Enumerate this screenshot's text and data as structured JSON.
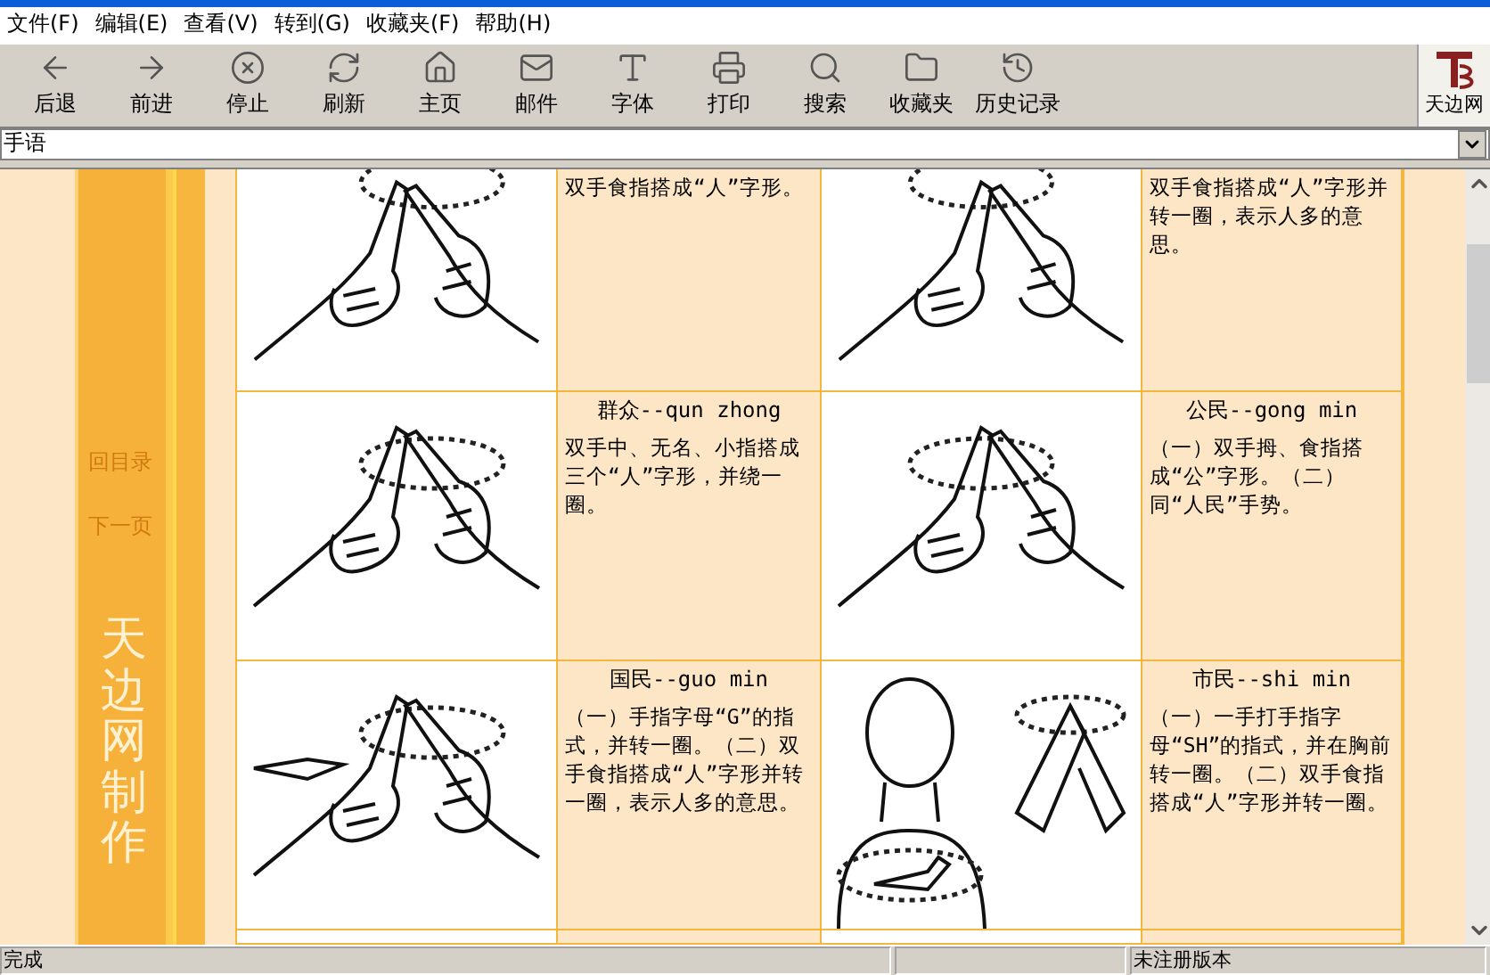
{
  "menu": [
    "文件(F)",
    "编辑(E)",
    "查看(V)",
    "转到(G)",
    "收藏夹(F)",
    "帮助(H)"
  ],
  "toolbar": [
    {
      "kind": "back",
      "label": "后退"
    },
    {
      "kind": "forward",
      "label": "前进"
    },
    {
      "kind": "stop",
      "label": "停止"
    },
    {
      "kind": "refresh",
      "label": "刷新"
    },
    {
      "kind": "home",
      "label": "主页"
    },
    {
      "kind": "mail",
      "label": "邮件"
    },
    {
      "kind": "font",
      "label": "字体"
    },
    {
      "kind": "print",
      "label": "打印"
    },
    {
      "kind": "search",
      "label": "搜索"
    },
    {
      "kind": "favorites",
      "label": "收藏夹"
    },
    {
      "kind": "history",
      "label": "历史记录"
    }
  ],
  "logo": {
    "text": "天边网"
  },
  "address": {
    "value": "手语"
  },
  "sidebar": {
    "links": [
      "回目录",
      "下一页"
    ],
    "watermark": "天边网制作"
  },
  "signs": [
    [
      {
        "description": "双手食指搭成“人”字形。"
      },
      {
        "description": "双手食指搭成“人”字形并转一圈，表示人多的意思。"
      }
    ],
    [
      {
        "title": "群众--qun zhong",
        "description": "双手中、无名、小指搭成三个“人”字形，并绕一圈。"
      },
      {
        "title": "公民--gong min",
        "description": "（一）双手拇、食指搭成“公”字形。（二）同“人民”手势。"
      }
    ],
    [
      {
        "title": "国民--guo min",
        "description": "（一）手指字母“G”的指式，并转一圈。（二）双手食指搭成“人”字形并转一圈，表示人多的意思。"
      },
      {
        "title": "市民--shi min",
        "description": "（一）一手打手指字母“SH”的指式，并在胸前转一圈。（二）双手食指搭成“人”字形并转一圈。"
      }
    ]
  ],
  "status": [
    "完成",
    "未注册版本"
  ]
}
